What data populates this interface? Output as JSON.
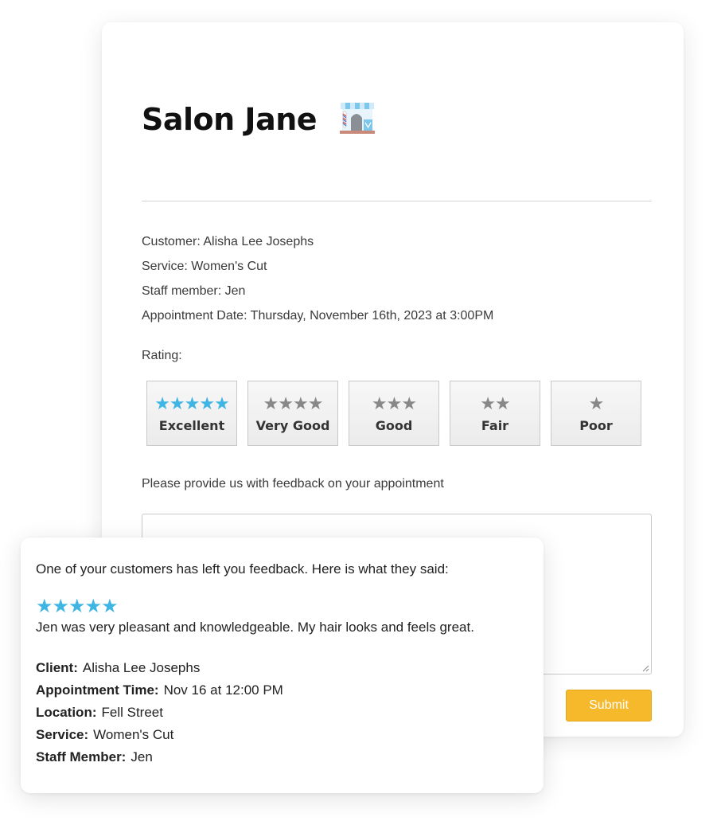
{
  "form": {
    "title": "Salon Jane",
    "customer": "Customer: Alisha Lee Josephs",
    "service": "Service: Women's Cut",
    "staff": "Staff member: Jen",
    "appointment_date": "Appointment Date: Thursday, November 16th, 2023 at 3:00PM",
    "rating_label": "Rating:",
    "rating_options": [
      {
        "stars": "★★★★★",
        "label": "Excellent",
        "selected": true
      },
      {
        "stars": "★★★★",
        "label": "Very Good",
        "selected": false
      },
      {
        "stars": "★★★",
        "label": "Good",
        "selected": false
      },
      {
        "stars": "★★",
        "label": "Fair",
        "selected": false
      },
      {
        "stars": "★",
        "label": "Poor",
        "selected": false
      }
    ],
    "feedback_prompt": "Please provide us with feedback on your appointment",
    "feedback_value": "",
    "submit_label": "Submit"
  },
  "notification": {
    "intro": "One of your customers has left you feedback. Here is what they said:",
    "stars": "★★★★★",
    "comment": "Jen was very pleasant and knowledgeable. My hair looks and feels great.",
    "details": [
      {
        "label": "Client:",
        "value": "Alisha Lee Josephs"
      },
      {
        "label": "Appointment Time:",
        "value": "Nov 16 at 12:00 PM"
      },
      {
        "label": "Location:",
        "value": "Fell Street"
      },
      {
        "label": "Service:",
        "value": "Women's Cut"
      },
      {
        "label": "Staff Member:",
        "value": "Jen"
      }
    ]
  },
  "icons": {
    "salon": "salon-storefront-icon",
    "resize": "resize-grip-icon"
  },
  "colors": {
    "star_selected": "#3fb5e3",
    "star_default": "#888888",
    "submit": "#f6b92b"
  }
}
